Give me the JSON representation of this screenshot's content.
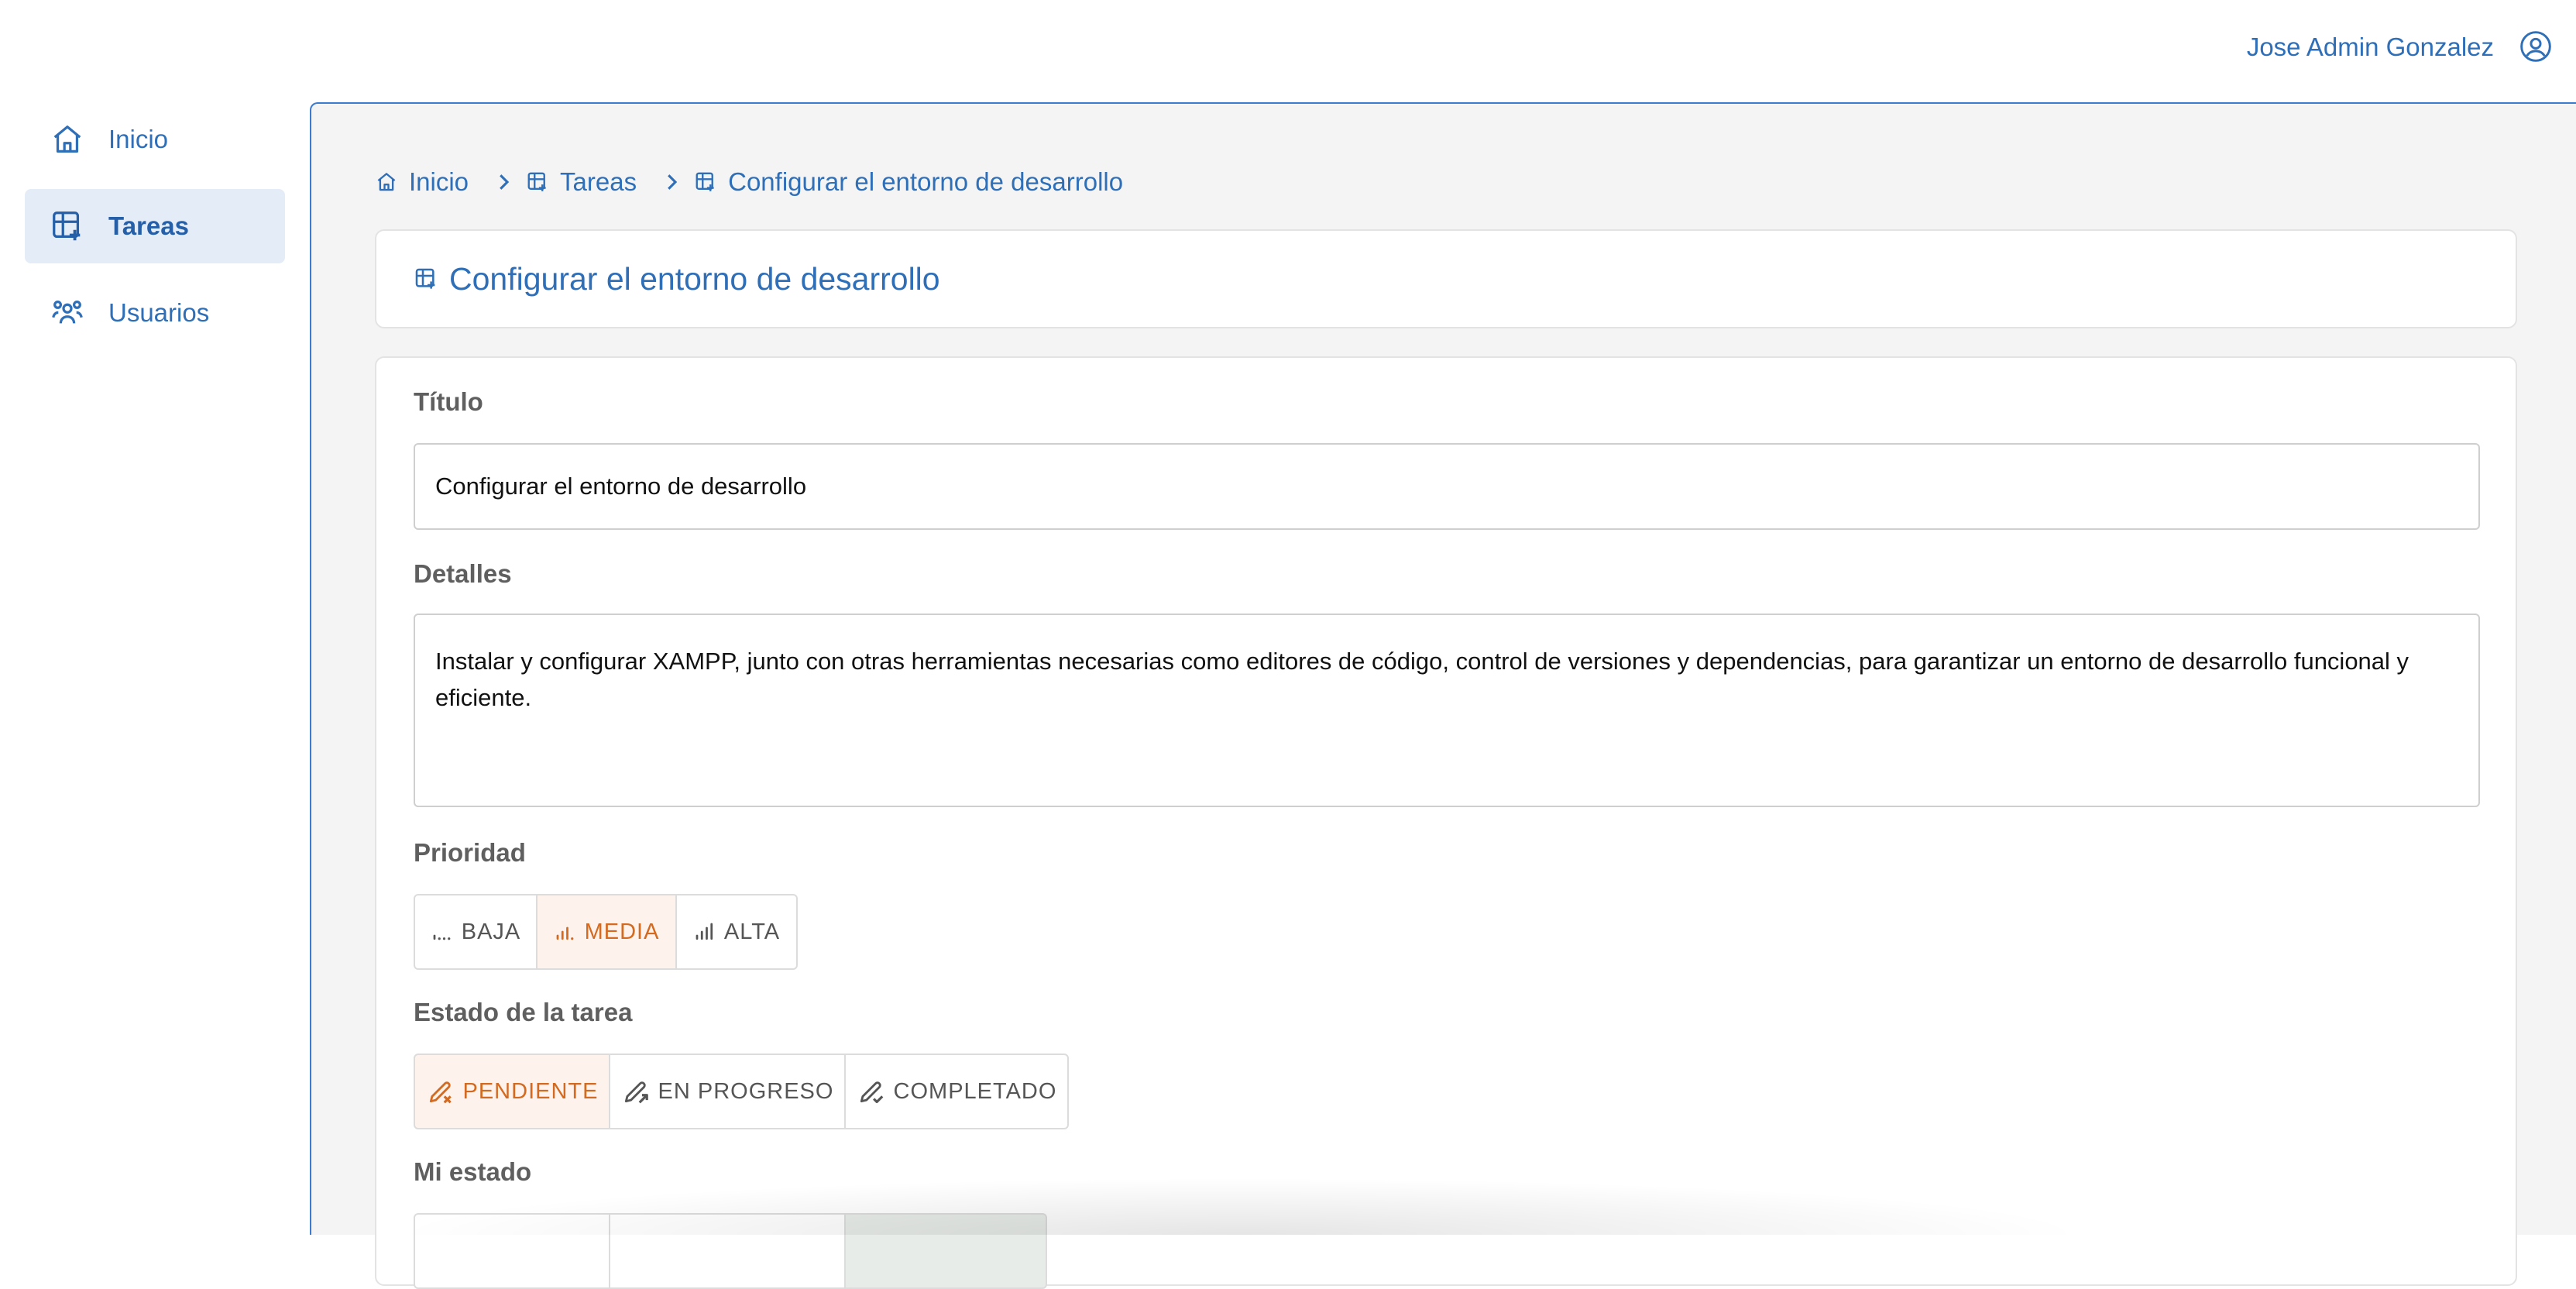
{
  "header": {
    "user_name": "Jose Admin Gonzalez"
  },
  "sidebar": {
    "items": [
      {
        "label": "Inicio",
        "icon": "home-icon",
        "active": false
      },
      {
        "label": "Tareas",
        "icon": "tasks-icon",
        "active": true
      },
      {
        "label": "Usuarios",
        "icon": "users-icon",
        "active": false
      }
    ]
  },
  "breadcrumb": [
    "Inicio",
    "Tareas",
    "Configurar el entorno de desarrollo"
  ],
  "page": {
    "title": "Configurar el entorno de desarrollo"
  },
  "form": {
    "title_label": "Título",
    "title_value": "Configurar el entorno de desarrollo",
    "details_label": "Detalles",
    "details_value": "Instalar y configurar XAMPP, junto con otras herramientas necesarias como editores de código, control de versiones y dependencias, para garantizar un entorno de desarrollo funcional y eficiente.",
    "priority_label": "Prioridad",
    "priority_options": [
      "BAJA",
      "MEDIA",
      "ALTA"
    ],
    "priority_selected": "MEDIA",
    "status_label": "Estado de la tarea",
    "status_options": [
      "PENDIENTE",
      "EN PROGRESO",
      "COMPLETADO"
    ],
    "status_selected": "PENDIENTE",
    "my_status_label": "Mi estado"
  },
  "colors": {
    "accent": "#2f6fb8",
    "selected_orange": "#d46a1f",
    "selected_bg": "#fdf2ec",
    "active_nav_bg": "#e4ecf7"
  }
}
